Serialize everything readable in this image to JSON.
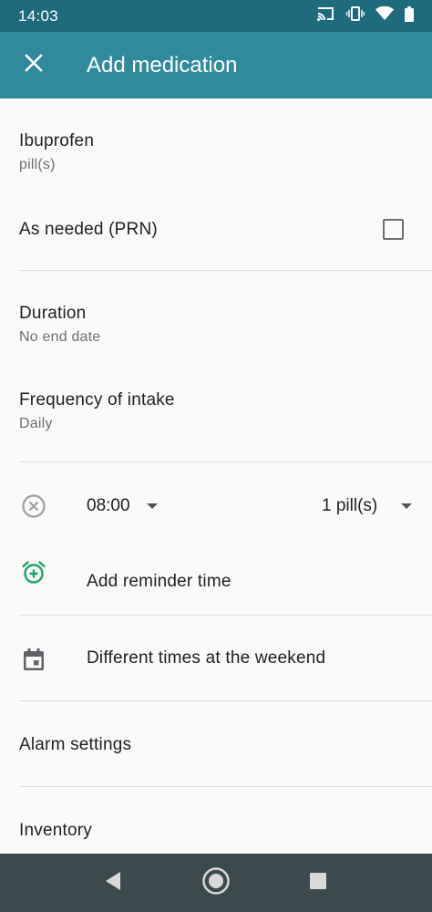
{
  "status_bar": {
    "time": "14:03"
  },
  "app_bar": {
    "title": "Add medication"
  },
  "medication": {
    "name": "Ibuprofen",
    "unit": "pill(s)"
  },
  "prn": {
    "label": "As needed (PRN)",
    "checked": false
  },
  "duration": {
    "label": "Duration",
    "value": "No end date"
  },
  "frequency": {
    "label": "Frequency of intake",
    "value": "Daily"
  },
  "reminder": {
    "time": "08:00",
    "dose": "1 pill(s)"
  },
  "add_reminder": {
    "label": "Add reminder time"
  },
  "weekend": {
    "label": "Different times at the weekend"
  },
  "alarm": {
    "label": "Alarm settings"
  },
  "inventory": {
    "label": "Inventory"
  },
  "colors": {
    "status_bar": "#1e6b7c",
    "app_bar": "#2f8a9c",
    "accent_green": "#1fa46a",
    "nav_bar": "#3c4a4e"
  }
}
